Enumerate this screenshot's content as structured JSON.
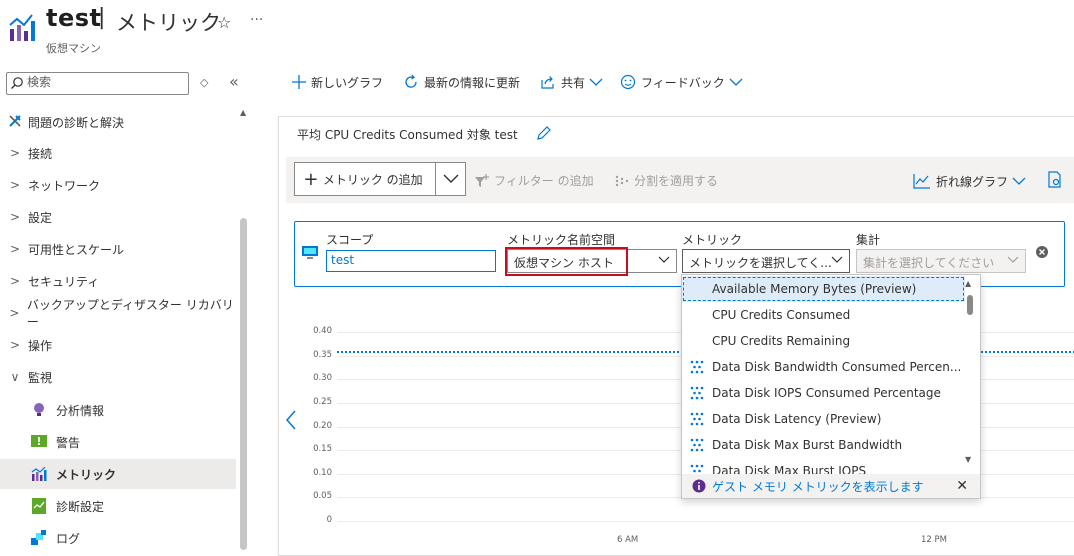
{
  "header": {
    "resource_name": "test",
    "separator": "|",
    "blade_title": "メトリック",
    "resource_type": "仮想マシン",
    "favorite_icon": "star-icon",
    "more_icon": "ellipsis-icon"
  },
  "sidebar": {
    "search_placeholder": "検索",
    "items": [
      {
        "label": "問題の診断と解決",
        "icon": "wrench-icon",
        "type": "top"
      },
      {
        "label": "接続",
        "type": "group"
      },
      {
        "label": "ネットワーク",
        "type": "group"
      },
      {
        "label": "設定",
        "type": "group"
      },
      {
        "label": "可用性とスケール",
        "type": "group"
      },
      {
        "label": "セキュリティ",
        "type": "group"
      },
      {
        "label": "バックアップとディザスター リカバリー",
        "type": "group"
      },
      {
        "label": "操作",
        "type": "group"
      },
      {
        "label": "監視",
        "type": "group-open"
      },
      {
        "label": "分析情報",
        "icon": "lightbulb-icon",
        "type": "sub"
      },
      {
        "label": "警告",
        "icon": "alert-icon",
        "type": "sub"
      },
      {
        "label": "メトリック",
        "icon": "metrics-icon",
        "type": "sub",
        "selected": true
      },
      {
        "label": "診断設定",
        "icon": "diagnostic-settings-icon",
        "type": "sub"
      },
      {
        "label": "ログ",
        "icon": "logs-icon",
        "type": "sub"
      }
    ]
  },
  "toolbar": {
    "new_chart": "新しいグラフ",
    "refresh": "最新の情報に更新",
    "share": "共有",
    "feedback": "フィードバック"
  },
  "chart": {
    "title": "平均 CPU Credits Consumed 対象 test",
    "add_metric": "メトリック の追加",
    "add_filter": "フィルター の追加",
    "apply_split": "分割を適用する",
    "chart_type": "折れ線グラフ"
  },
  "metric_row": {
    "scope_label": "スコープ",
    "scope_value": "test",
    "namespace_label": "メトリック名前空間",
    "namespace_value": "仮想マシン ホスト",
    "metric_label": "メトリック",
    "metric_placeholder": "メトリックを選択してく...",
    "aggregation_label": "集計",
    "aggregation_placeholder": "集計を選択してください"
  },
  "dropdown": {
    "options": [
      {
        "label": "Available Memory Bytes (Preview)",
        "icon": null,
        "highlighted": true
      },
      {
        "label": "CPU Credits Consumed",
        "icon": null
      },
      {
        "label": "CPU Credits Remaining",
        "icon": null
      },
      {
        "label": "Data Disk Bandwidth Consumed Percen...",
        "icon": "multi-dimension-icon"
      },
      {
        "label": "Data Disk IOPS Consumed Percentage",
        "icon": "multi-dimension-icon"
      },
      {
        "label": "Data Disk Latency (Preview)",
        "icon": "multi-dimension-icon"
      },
      {
        "label": "Data Disk Max Burst Bandwidth",
        "icon": "multi-dimension-icon"
      },
      {
        "label": "Data Disk Max Burst IOPS",
        "icon": "multi-dimension-icon"
      }
    ],
    "info_text": "ゲスト メモリ メトリックを表示します"
  },
  "chart_data": {
    "type": "line",
    "y_ticks": [
      "0.40",
      "0.35",
      "0.30",
      "0.25",
      "0.20",
      "0.15",
      "0.10",
      "0.05",
      "0"
    ],
    "x_ticks": [
      "6 AM",
      "12 PM"
    ],
    "ylim": [
      0,
      0.4
    ],
    "series": [
      {
        "values": [
          0.36,
          0.36
        ],
        "style": "dashed",
        "color": "#0078d4"
      }
    ],
    "grid": true
  }
}
